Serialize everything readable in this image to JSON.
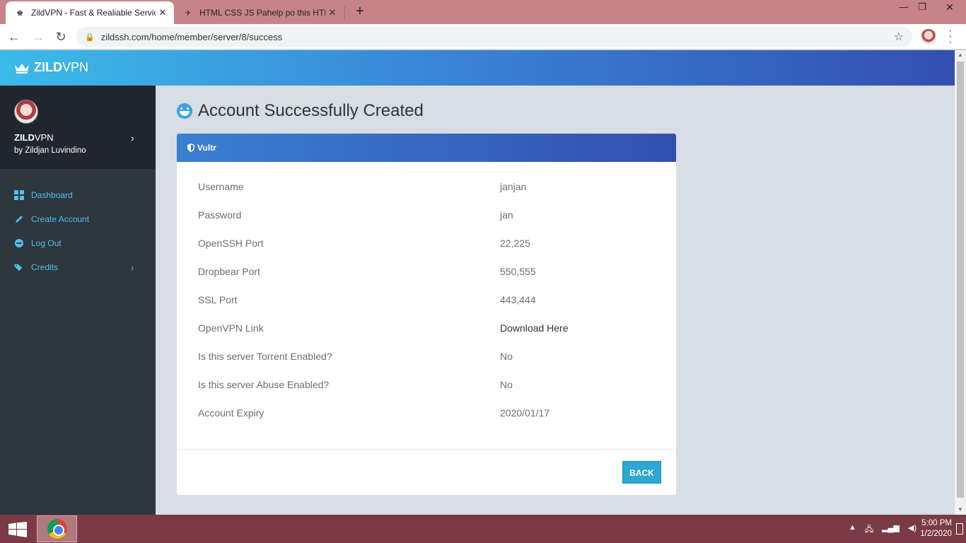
{
  "browser": {
    "tabs": [
      {
        "title": "ZildVPN - Fast & Realiable Servic",
        "active": true
      },
      {
        "title": "HTML CSS JS Pahelp po this HTM",
        "active": false
      }
    ],
    "url": "zildssh.com/home/member/server/8/success",
    "new_tab": "+",
    "close": "✕"
  },
  "app": {
    "brand_bold": "ZILD",
    "brand_light": "VPN"
  },
  "sidebar": {
    "user_bold": "ZILD",
    "user_light": "VPN",
    "subtitle": "by Zildjan Luvindino",
    "items": [
      {
        "label": "Dashboard",
        "icon": "dashboard-icon"
      },
      {
        "label": "Create Account",
        "icon": "pencil-icon"
      },
      {
        "label": "Log Out",
        "icon": "logout-icon"
      },
      {
        "label": "Credits",
        "icon": "tag-icon"
      }
    ]
  },
  "main": {
    "title": "Account Successfully Created",
    "card_title": "Vultr",
    "rows": [
      {
        "label": "Username",
        "value": "janjan"
      },
      {
        "label": "Password",
        "value": "jan"
      },
      {
        "label": "OpenSSH Port",
        "value": "22,225"
      },
      {
        "label": "Dropbear Port",
        "value": "550,555"
      },
      {
        "label": "SSL Port",
        "value": "443,444"
      },
      {
        "label": "OpenVPN Link",
        "value": "Download Here"
      },
      {
        "label": "Is this server Torrent Enabled?",
        "value": "No"
      },
      {
        "label": "Is this server Abuse Enabled?",
        "value": "No"
      },
      {
        "label": "Account Expiry",
        "value": "2020/01/17"
      }
    ],
    "back_label": "BACK"
  },
  "taskbar": {
    "time": "5:00 PM",
    "date": "1/2/2020"
  },
  "colors": {
    "accent": "#3aa3de",
    "sidebar": "#2e3640",
    "button": "#2ea7d3"
  }
}
